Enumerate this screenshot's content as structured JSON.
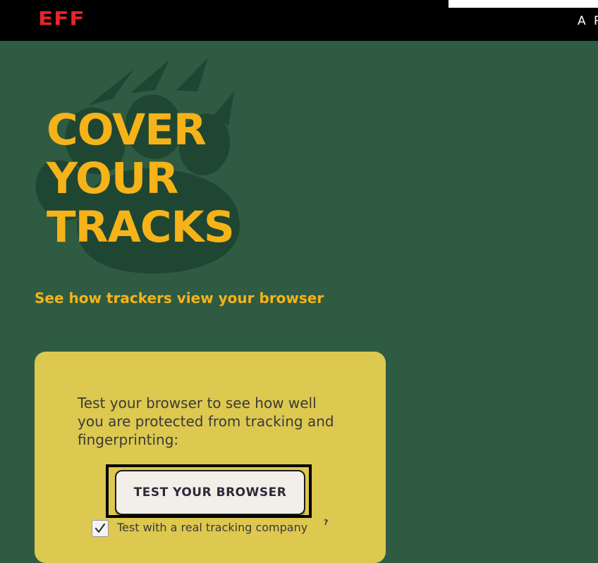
{
  "header": {
    "logo_text": "EFF",
    "top_link_text": "A P",
    "search_value": "",
    "colors": {
      "background": "#000000",
      "logo": "#e8232a"
    }
  },
  "hero": {
    "title_lines": [
      "COVER",
      "YOUR",
      "TRACKS"
    ],
    "tagline": "See how trackers view your browser",
    "paw_icon": "paw-print-icon",
    "colors": {
      "background": "#2f5b43",
      "accent": "#f5b319",
      "paw": "#1f4632"
    }
  },
  "card": {
    "description": "Test your browser to see how well you are protected from tracking and fingerprinting:",
    "button_label": "TEST YOUR BROWSER",
    "checkbox": {
      "label": "Test with a real tracking company",
      "checked": true,
      "help_mark": "?"
    },
    "colors": {
      "background": "#ddc850",
      "button": "#f2efe8"
    }
  }
}
